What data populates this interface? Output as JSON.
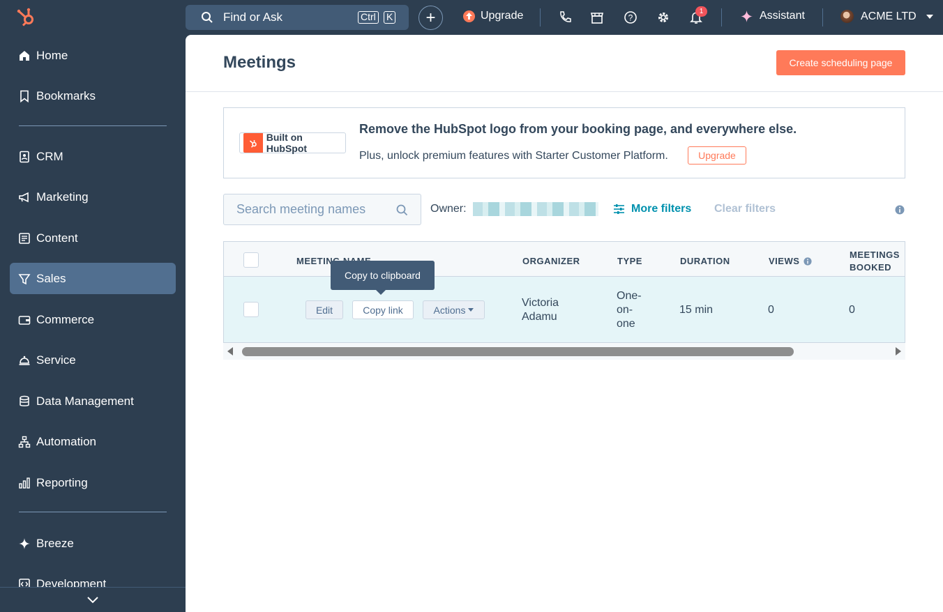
{
  "topbar": {
    "search_label": "Find or Ask",
    "kbd_ctrl": "Ctrl",
    "kbd_k": "K",
    "upgrade_label": "Upgrade",
    "notification_count": "1",
    "assistant_label": "Assistant",
    "account_name": "ACME LTD"
  },
  "sidebar": {
    "items": [
      {
        "label": "Home",
        "icon": "home-icon"
      },
      {
        "label": "Bookmarks",
        "icon": "bookmark-icon"
      },
      {
        "label": "CRM",
        "icon": "contacts-icon"
      },
      {
        "label": "Marketing",
        "icon": "megaphone-icon"
      },
      {
        "label": "Content",
        "icon": "content-icon"
      },
      {
        "label": "Sales",
        "icon": "sales-icon",
        "active": true
      },
      {
        "label": "Commerce",
        "icon": "wallet-icon"
      },
      {
        "label": "Service",
        "icon": "service-bell-icon"
      },
      {
        "label": "Data Management",
        "icon": "database-icon"
      },
      {
        "label": "Automation",
        "icon": "workflow-icon"
      },
      {
        "label": "Reporting",
        "icon": "bar-chart-icon"
      },
      {
        "label": "Breeze",
        "icon": "sparkle-icon"
      },
      {
        "label": "Development",
        "icon": "code-icon"
      }
    ]
  },
  "page": {
    "title": "Meetings",
    "create_button": "Create scheduling page"
  },
  "banner": {
    "badge_text": "Built on HubSpot",
    "title": "Remove the HubSpot logo from your booking page, and everywhere else.",
    "subtitle": "Plus, unlock premium features with Starter Customer Platform.",
    "upgrade_button": "Upgrade"
  },
  "filters": {
    "search_placeholder": "Search meeting names",
    "owner_label": "Owner:",
    "more_filters": "More filters",
    "clear_filters": "Clear filters"
  },
  "table": {
    "columns": {
      "name": "MEETING NAME",
      "organizer": "ORGANIZER",
      "type": "TYPE",
      "duration": "DURATION",
      "views": "VIEWS",
      "booked_1": "MEETINGS",
      "booked_2": "BOOKED"
    },
    "rows": [
      {
        "edit": "Edit",
        "copy_link": "Copy link",
        "actions": "Actions",
        "organizer_1": "Victoria",
        "organizer_2": "Adamu",
        "type_1": "One-",
        "type_2": "on-",
        "type_3": "one",
        "duration": "15 min",
        "views": "0",
        "booked": "0"
      }
    ],
    "tooltip": "Copy to clipboard"
  },
  "colors": {
    "sidebar_bg": "#2d3e50",
    "accent": "#ff7a59",
    "link": "#0091ae",
    "row_highlight": "#e5f5f8"
  }
}
